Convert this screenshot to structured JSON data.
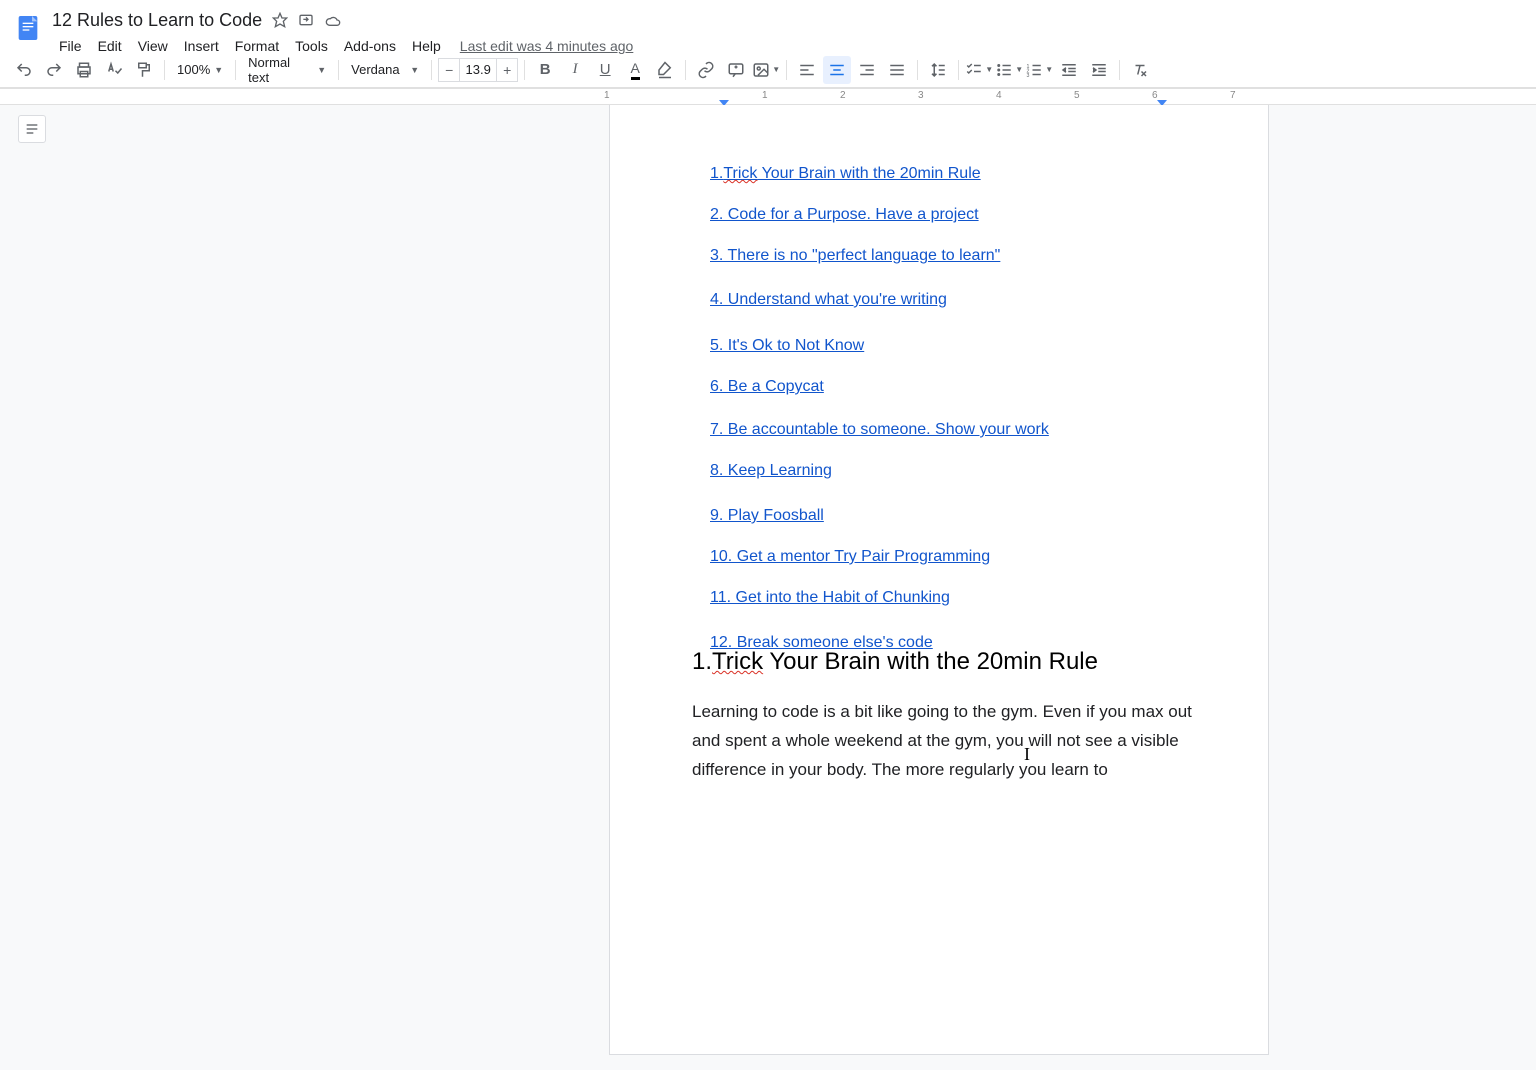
{
  "header": {
    "title": "12 Rules to Learn to Code",
    "menu": [
      "File",
      "Edit",
      "View",
      "Insert",
      "Format",
      "Tools",
      "Add-ons",
      "Help"
    ],
    "status": "Last edit was 4 minutes ago"
  },
  "toolbar": {
    "zoom": "100%",
    "style": "Normal text",
    "font": "Verdana",
    "fontSize": "13.9"
  },
  "ruler": {
    "ticks": [
      "1",
      "1",
      "2",
      "3",
      "4",
      "5",
      "6",
      "7"
    ]
  },
  "toc": [
    {
      "pre": "1.",
      "spell": "Trick",
      "rest": " Your Brain with the 20min Rule"
    },
    {
      "text": "2. Code for a Purpose. Have a project"
    },
    {
      "text": "3. There is no \"perfect language to learn\""
    },
    {
      "text": "4. Understand what you're writing"
    },
    {
      "text": "5. It's Ok to Not Know"
    },
    {
      "text": "6. Be a Copycat"
    },
    {
      "text": "7. Be accountable to someone. Show your work"
    },
    {
      "text": "8. Keep Learning"
    },
    {
      "text": "9. Play Foosball"
    },
    {
      "text": "10. Get a mentor  Try Pair Programming"
    },
    {
      "text": "11. Get into the Habit of Chunking"
    },
    {
      "text": "12. Break someone else's code"
    }
  ],
  "heading": {
    "num": "1.",
    "spell": "Trick",
    "rest": " Your Brain with the 20min Rule"
  },
  "body": "Learning to code is a bit like going to the gym. Even if you max out and spent a whole weekend at the gym, you will not see a visible difference in your body. The more regularly you learn to"
}
